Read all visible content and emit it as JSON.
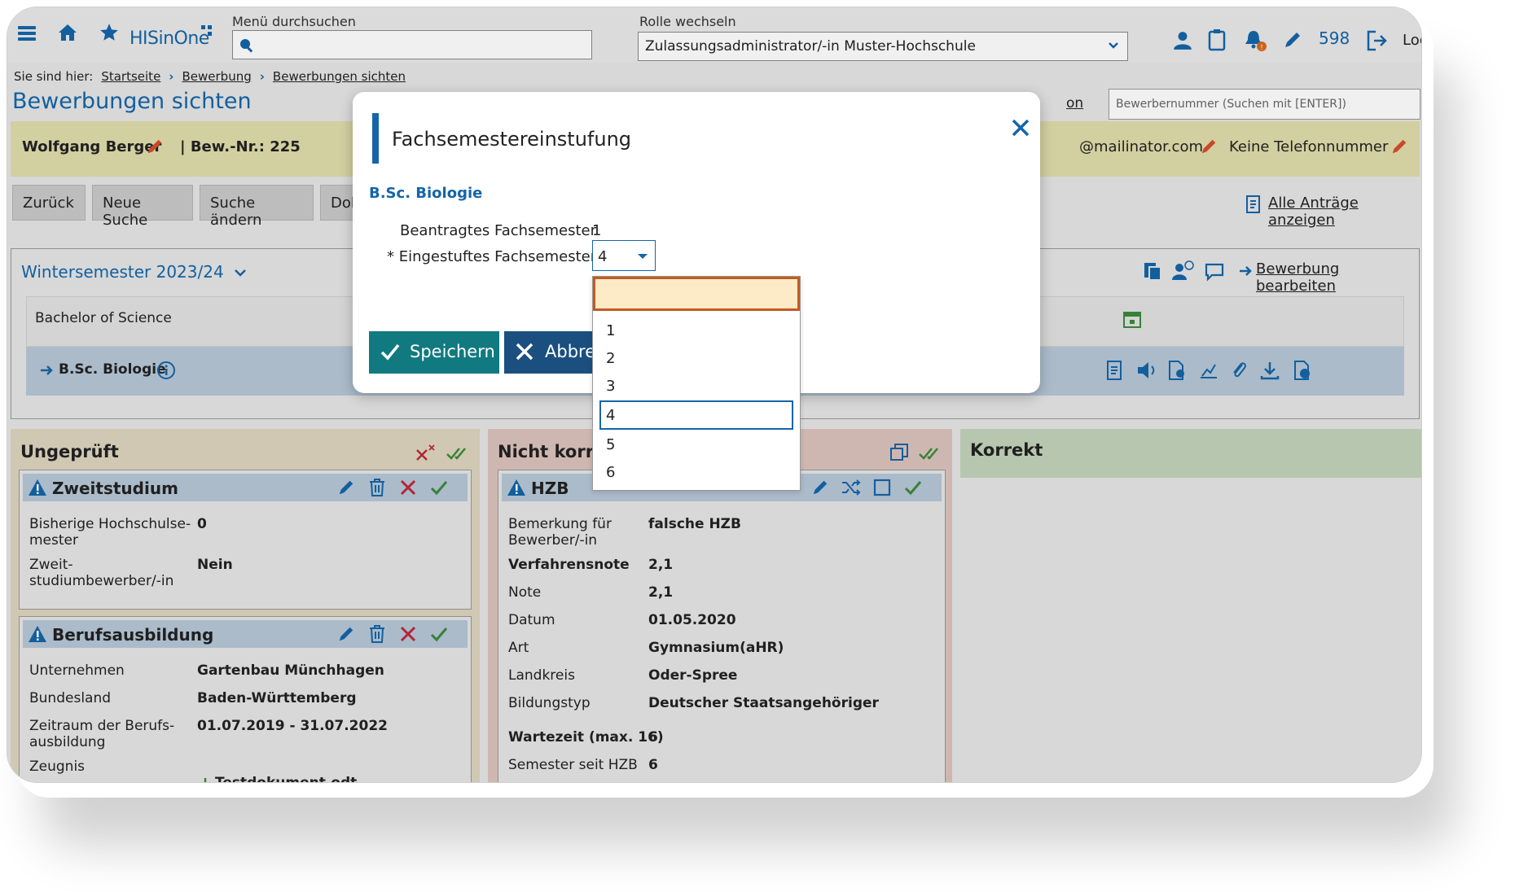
{
  "header": {
    "logo_text": "HISinOne",
    "menu_search_label": "Menü durchsuchen",
    "role_label": "Rolle wechseln",
    "role_value": "Zulassungsadministrator/-in Muster-Hochschule",
    "count": "598",
    "logout_text": "Log"
  },
  "breadcrumb": {
    "prefix": "Sie sind hier:",
    "items": [
      "Startseite",
      "Bewerbung",
      "Bewerbungen sichten"
    ]
  },
  "page": {
    "title": "Bewerbungen sichten",
    "hidden_link": "on",
    "search_placeholder": "Bewerbernummer (Suchen mit [ENTER])"
  },
  "applicant": {
    "name": "Wolfgang Berger",
    "bew_nr": "| Bew.-Nr.: 225",
    "email": "@mailinator.com",
    "phone": "Keine Telefonnummer"
  },
  "actions": {
    "back": "Zurück",
    "new_search": "Neue Suche",
    "change_search": "Suche ändern",
    "doc": "Dok",
    "all_requests": "Alle Anträge anzeigen"
  },
  "semester": {
    "title": "Wintersemester 2023/24",
    "edit_link": "Bewerbung bearbeiten",
    "degree": "Bachelor of Science",
    "program": "B.Sc. Biologie"
  },
  "columns": {
    "ungeprueft": "Ungeprüft",
    "nicht_korrekt": "Nicht korrekt",
    "korrekt": "Korrekt"
  },
  "cards": {
    "zweitstudium": {
      "title": "Zweitstudium",
      "rows": [
        {
          "label": "Bisherige Hochschulse-\nmester",
          "value": "0"
        },
        {
          "label": "Zweit-\nstudiumbewerber/-in",
          "value": "Nein"
        }
      ]
    },
    "berufsausbildung": {
      "title": "Berufsausbildung",
      "rows": [
        {
          "label": "Unternehmen",
          "value": "Gartenbau Münchhagen"
        },
        {
          "label": "Bundesland",
          "value": "Baden-Württemberg"
        },
        {
          "label": "Zeitraum der Berufs-\nausbildung",
          "value": "01.07.2019 - 31.07.2022"
        },
        {
          "label": "Zeugnis",
          "value": "Testdokument.odt"
        }
      ]
    },
    "hzb": {
      "title": "HZB",
      "rows": [
        {
          "label": "Bemerkung für\nBewerber/-in",
          "value": "falsche HZB"
        },
        {
          "label": "Verfahrensnote",
          "value": "2,1"
        },
        {
          "label": "Note",
          "value": "2,1"
        },
        {
          "label": "Datum",
          "value": "01.05.2020"
        },
        {
          "label": "Art",
          "value": "Gymnasium(aHR)"
        },
        {
          "label": "Landkreis",
          "value": "Oder-Spree"
        },
        {
          "label": "Bildungstyp",
          "value": "Deutscher Staatsangehöriger"
        },
        {
          "label": "Wartezeit (max. 16)",
          "value": "6"
        },
        {
          "label": "Semester seit HZB",
          "value": "6"
        }
      ]
    }
  },
  "modal": {
    "title": "Fachsemestereinstufung",
    "subtitle": "B.Sc. Biologie",
    "requested_label": "Beantragtes Fachsemester",
    "requested_value": "1",
    "assigned_label": "* Eingestuftes Fachsemester",
    "assigned_value": "4",
    "save": "Speichern",
    "cancel": "Abbre"
  },
  "dropdown": {
    "options": [
      "1",
      "2",
      "3",
      "4",
      "5",
      "6"
    ],
    "selected": "4"
  },
  "colors": {
    "brand_blue": "#1565a8",
    "save_green": "#117a80",
    "cancel_blue": "#1a4f80",
    "applicant_bar": "#e0dcab"
  }
}
